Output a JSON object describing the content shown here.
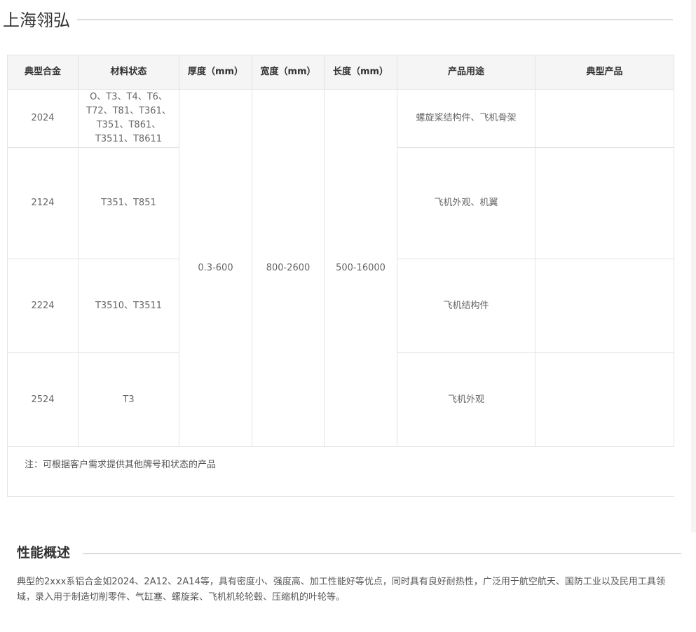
{
  "brand": {
    "title": "上海翎弘"
  },
  "table": {
    "headers": [
      "典型合金",
      "材料状态",
      "厚度（mm）",
      "宽度（mm）",
      "长度（mm）",
      "产品用途",
      "典型产品"
    ],
    "shared": {
      "thickness": "0.3-600",
      "width": "800-2600",
      "length": "500-16000"
    },
    "rows": [
      {
        "alloy": "2024",
        "temper": "O、T3、T4、T6、T72、T81、T361、T351、T861、T3511、T8611",
        "usage": "螺旋桨结构件、飞机骨架",
        "product": ""
      },
      {
        "alloy": "2124",
        "temper": "T351、T851",
        "usage": "飞机外观、机翼",
        "product": ""
      },
      {
        "alloy": "2224",
        "temper": "T3510、T3511",
        "usage": "飞机结构件",
        "product": ""
      },
      {
        "alloy": "2524",
        "temper": "T3",
        "usage": "飞机外观",
        "product": ""
      }
    ],
    "note": "注：可根据客户需求提供其他牌号和状态的产品"
  },
  "overview": {
    "title": "性能概述",
    "text": "典型的2xxx系铝合金如2024、2A12、2A14等，具有密度小、强度高、加工性能好等优点，同时具有良好耐热性，广泛用于航空航天、国防工业以及民用工具领域，录入用于制造切削零件、气缸塞、螺旋桨、飞机机轮轮毂、压缩机的叶轮等。"
  }
}
